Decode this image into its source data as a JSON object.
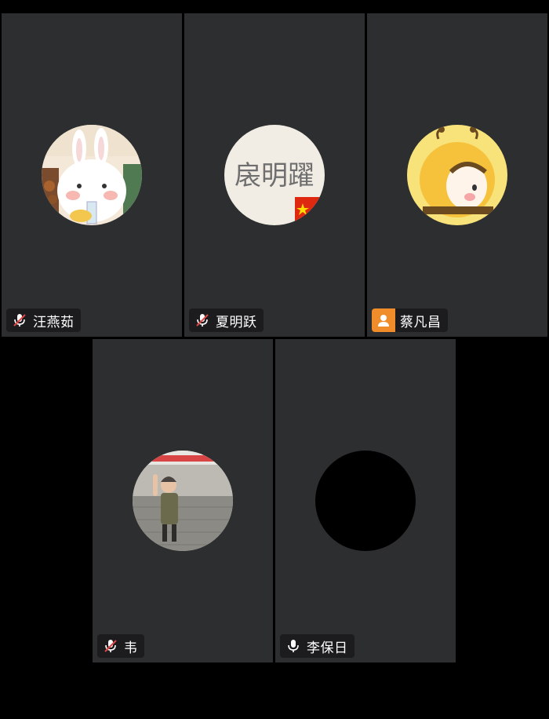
{
  "participants": [
    {
      "name": "汪燕茹",
      "mic": "muted",
      "avatar": "bunny-drink-avatar"
    },
    {
      "name": "夏明跃",
      "mic": "muted",
      "avatar": "calligraphy-avatar"
    },
    {
      "name": "蔡凡昌",
      "mic": "no-audio",
      "avatar": "bee-costume-avatar"
    },
    {
      "name": "韦",
      "mic": "muted",
      "avatar": "child-photo-avatar"
    },
    {
      "name": "李保日",
      "mic": "active",
      "avatar": "black-avatar"
    }
  ],
  "avatar_text": {
    "calligraphy": "扆明躍"
  },
  "colors": {
    "background": "#000000",
    "tile": "#2d2e30",
    "label_bg": "#161618",
    "badge_orange": "#f08c2a",
    "muted_red": "#e04646"
  }
}
